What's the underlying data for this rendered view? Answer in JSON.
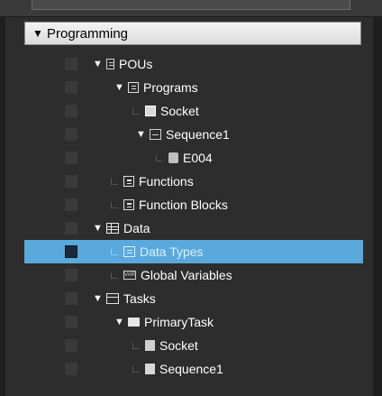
{
  "section": {
    "title": "Programming",
    "expand_glyph": "▼"
  },
  "glyphs": {
    "expanded": "▼",
    "elbow": "∟"
  },
  "tree": [
    {
      "label": "POUs",
      "level": 1,
      "type": "expanded",
      "icon": "pou-icon"
    },
    {
      "label": "Programs",
      "level": 2,
      "type": "expanded",
      "icon": "programs-icon"
    },
    {
      "label": "Socket",
      "level": 3,
      "type": "leaf",
      "icon": "program-icon"
    },
    {
      "label": "Sequence1",
      "level": 3,
      "type": "expanded",
      "icon": "ladder-program-icon"
    },
    {
      "label": "E004",
      "level": 4,
      "type": "leaf",
      "icon": "function-block-icon"
    },
    {
      "label": "Functions",
      "level": 2,
      "type": "leaf",
      "icon": "functions-icon"
    },
    {
      "label": "Function Blocks",
      "level": 2,
      "type": "leaf",
      "icon": "function-blocks-icon"
    },
    {
      "label": "Data",
      "level": 1,
      "type": "expanded",
      "icon": "data-table-icon"
    },
    {
      "label": "Data Types",
      "level": 2,
      "type": "leaf",
      "icon": "data-types-icon",
      "selected": true
    },
    {
      "label": "Global Variables",
      "level": 2,
      "type": "leaf",
      "icon": "global-variables-icon"
    },
    {
      "label": "Tasks",
      "level": 1,
      "type": "expanded",
      "icon": "tasks-icon"
    },
    {
      "label": "PrimaryTask",
      "level": 2,
      "type": "expanded",
      "icon": "folder-icon"
    },
    {
      "label": "Socket",
      "level": 3,
      "type": "leaf",
      "icon": "task-program-icon"
    },
    {
      "label": "Sequence1",
      "level": 3,
      "type": "leaf",
      "icon": "task-sequence-icon"
    }
  ],
  "icon_text": {
    "global_variables": "VAR"
  },
  "colors": {
    "background": "#2d2d2d",
    "selection": "#5aa9dc",
    "text": "#ffffff",
    "checkbox": "#3a3a3a"
  }
}
